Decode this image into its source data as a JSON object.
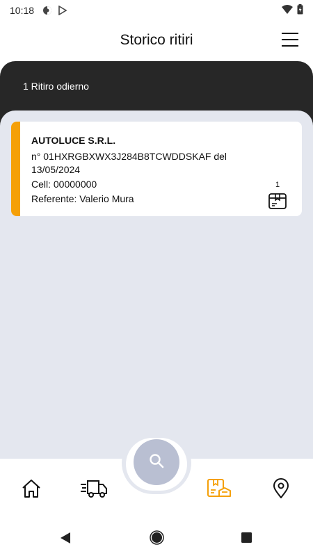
{
  "status_bar": {
    "time": "10:18"
  },
  "header": {
    "title": "Storico ritiri"
  },
  "summary": {
    "count_label": "1 Ritiro odierno"
  },
  "pickups": [
    {
      "company": "AUTOLUCE S.R.L.",
      "number_line": "n° 01HXRGBXWX3J284B8TCWDDSKAF del",
      "date": "13/05/2024",
      "phone": "Cell: 00000000",
      "referent": "Referente: Valerio Mura",
      "package_count": "1",
      "accent_color": "#f5a008"
    }
  ],
  "bottom_nav": {
    "items": [
      "home-icon",
      "delivery-truck-icon",
      "search-icon",
      "pickup-history-icon",
      "location-pin-icon"
    ],
    "active": "pickup-history-icon",
    "active_color": "#f5a008"
  }
}
